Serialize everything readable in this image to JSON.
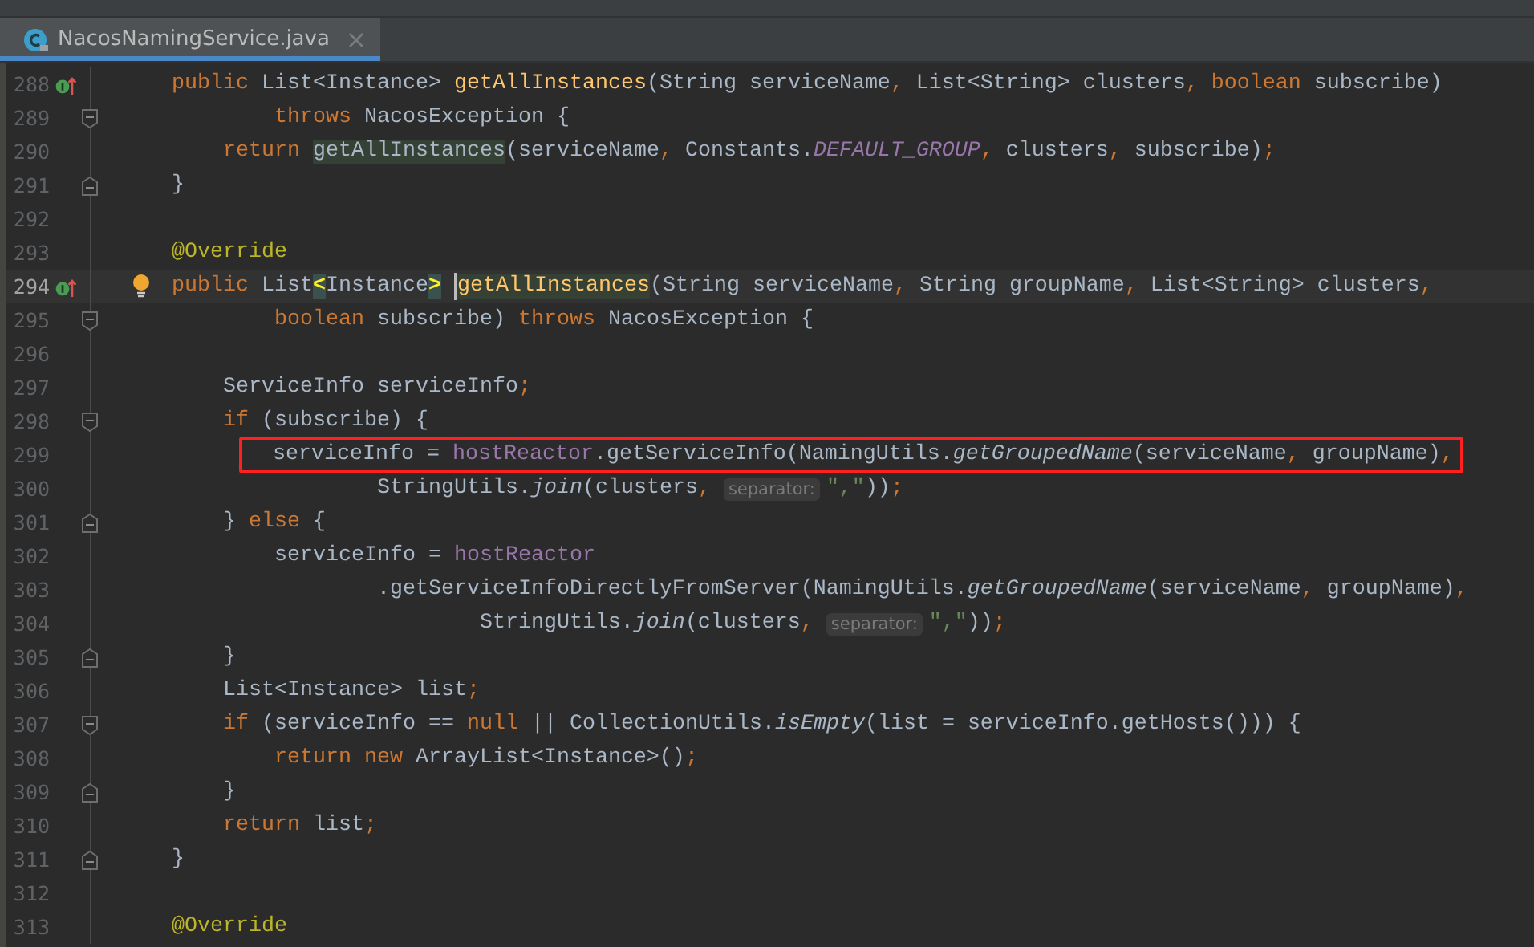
{
  "tab": {
    "title": "NacosNamingService.java",
    "selected": true
  },
  "lines": [
    {
      "number": "288",
      "current": false,
      "boxed": false,
      "markers": [
        {
          "kind": "implements"
        }
      ],
      "tokens": [
        {
          "kind": "keyword",
          "text": "    public"
        },
        {
          "kind": "plain",
          "text": " List<Instance> "
        },
        {
          "kind": "decl",
          "text": "getAllInstances"
        },
        {
          "kind": "plain",
          "text": "(String serviceName"
        },
        {
          "kind": "punct",
          "text": ","
        },
        {
          "kind": "plain",
          "text": " List<String> clusters"
        },
        {
          "kind": "punct",
          "text": ","
        },
        {
          "kind": "keyword",
          "text": " boolean"
        },
        {
          "kind": "plain",
          "text": " subscribe)"
        }
      ]
    },
    {
      "number": "289",
      "current": false,
      "boxed": false,
      "fold": {
        "kind": "start"
      },
      "tokens": [
        {
          "kind": "keyword",
          "text": "            throws"
        },
        {
          "kind": "plain",
          "text": " NacosException {"
        }
      ]
    },
    {
      "number": "290",
      "current": false,
      "boxed": false,
      "tokens": [
        {
          "kind": "keyword",
          "text": "        return "
        },
        {
          "kind": "usage",
          "text": "getAllInstances"
        },
        {
          "kind": "plain",
          "text": "(serviceName"
        },
        {
          "kind": "punct",
          "text": ","
        },
        {
          "kind": "plain",
          "text": " Constants."
        },
        {
          "kind": "static-field",
          "text": "DEFAULT_GROUP"
        },
        {
          "kind": "punct",
          "text": ","
        },
        {
          "kind": "plain",
          "text": " clusters"
        },
        {
          "kind": "punct",
          "text": ","
        },
        {
          "kind": "plain",
          "text": " subscribe)"
        },
        {
          "kind": "punct",
          "text": ";"
        }
      ]
    },
    {
      "number": "291",
      "current": false,
      "boxed": false,
      "fold": {
        "kind": "end"
      },
      "tokens": [
        {
          "kind": "plain",
          "text": "    }"
        }
      ]
    },
    {
      "number": "292",
      "current": false,
      "boxed": false
    },
    {
      "number": "293",
      "current": false,
      "boxed": false,
      "tokens": [
        {
          "kind": "annotation",
          "text": "    @Override"
        }
      ]
    },
    {
      "number": "294",
      "current": true,
      "boxed": false,
      "markers": [
        {
          "kind": "implements"
        },
        {
          "kind": "bulb"
        }
      ],
      "tokens": [
        {
          "kind": "keyword",
          "text": "    public"
        },
        {
          "kind": "plain",
          "text": " List"
        },
        {
          "kind": "brace-match",
          "text": "<"
        },
        {
          "kind": "plain",
          "text": "Instance"
        },
        {
          "kind": "brace-match",
          "text": ">"
        },
        {
          "kind": "caret"
        },
        {
          "kind": "decl-usage",
          "text": "getAllInstances"
        },
        {
          "kind": "plain",
          "text": "(String serviceName"
        },
        {
          "kind": "punct",
          "text": ","
        },
        {
          "kind": "plain",
          "text": " String groupName"
        },
        {
          "kind": "punct",
          "text": ","
        },
        {
          "kind": "plain",
          "text": " List<String> clusters"
        },
        {
          "kind": "punct",
          "text": ","
        }
      ]
    },
    {
      "number": "295",
      "current": false,
      "boxed": false,
      "fold": {
        "kind": "start"
      },
      "tokens": [
        {
          "kind": "keyword",
          "text": "            boolean"
        },
        {
          "kind": "plain",
          "text": " subscribe) "
        },
        {
          "kind": "keyword",
          "text": "throws"
        },
        {
          "kind": "plain",
          "text": " NacosException {"
        }
      ]
    },
    {
      "number": "296",
      "current": false,
      "boxed": false
    },
    {
      "number": "297",
      "current": false,
      "boxed": false,
      "tokens": [
        {
          "kind": "plain",
          "text": "        ServiceInfo serviceInfo"
        },
        {
          "kind": "punct",
          "text": ";"
        }
      ]
    },
    {
      "number": "298",
      "current": false,
      "boxed": false,
      "fold": {
        "kind": "start"
      },
      "tokens": [
        {
          "kind": "keyword",
          "text": "        if"
        },
        {
          "kind": "plain",
          "text": " (subscribe) {"
        }
      ]
    },
    {
      "number": "299",
      "current": false,
      "boxed": true,
      "tokens": [
        {
          "kind": "plain",
          "text": "            serviceInfo = "
        },
        {
          "kind": "field",
          "text": "hostReactor"
        },
        {
          "kind": "plain",
          "text": ".getServiceInfo(NamingUtils."
        },
        {
          "kind": "static-method",
          "text": "getGroupedName"
        },
        {
          "kind": "plain",
          "text": "(serviceName"
        },
        {
          "kind": "punct",
          "text": ","
        },
        {
          "kind": "plain",
          "text": " groupName)"
        },
        {
          "kind": "punct",
          "text": ","
        }
      ]
    },
    {
      "number": "300",
      "current": false,
      "boxed": false,
      "tokens": [
        {
          "kind": "plain",
          "text": "                    StringUtils."
        },
        {
          "kind": "static-method",
          "text": "join"
        },
        {
          "kind": "plain",
          "text": "(clusters"
        },
        {
          "kind": "punct",
          "text": ","
        },
        {
          "kind": "hint",
          "text": "separator:"
        },
        {
          "kind": "string",
          "text": "\",\""
        },
        {
          "kind": "plain",
          "text": "))"
        },
        {
          "kind": "punct",
          "text": ";"
        }
      ]
    },
    {
      "number": "301",
      "current": false,
      "boxed": false,
      "fold": {
        "kind": "end"
      },
      "tokens": [
        {
          "kind": "plain",
          "text": "        } "
        },
        {
          "kind": "keyword",
          "text": "else"
        },
        {
          "kind": "plain",
          "text": " {"
        }
      ]
    },
    {
      "number": "302",
      "current": false,
      "boxed": false,
      "tokens": [
        {
          "kind": "plain",
          "text": "            serviceInfo = "
        },
        {
          "kind": "field",
          "text": "hostReactor"
        }
      ]
    },
    {
      "number": "303",
      "current": false,
      "boxed": false,
      "tokens": [
        {
          "kind": "plain",
          "text": "                    .getServiceInfoDirectlyFromServer(NamingUtils."
        },
        {
          "kind": "static-method",
          "text": "getGroupedName"
        },
        {
          "kind": "plain",
          "text": "(serviceName"
        },
        {
          "kind": "punct",
          "text": ","
        },
        {
          "kind": "plain",
          "text": " groupName)"
        },
        {
          "kind": "punct",
          "text": ","
        }
      ]
    },
    {
      "number": "304",
      "current": false,
      "boxed": false,
      "tokens": [
        {
          "kind": "plain",
          "text": "                            StringUtils."
        },
        {
          "kind": "static-method",
          "text": "join"
        },
        {
          "kind": "plain",
          "text": "(clusters"
        },
        {
          "kind": "punct",
          "text": ","
        },
        {
          "kind": "hint",
          "text": "separator:"
        },
        {
          "kind": "string",
          "text": "\",\""
        },
        {
          "kind": "plain",
          "text": "))"
        },
        {
          "kind": "punct",
          "text": ";"
        }
      ]
    },
    {
      "number": "305",
      "current": false,
      "boxed": false,
      "fold": {
        "kind": "end"
      },
      "tokens": [
        {
          "kind": "plain",
          "text": "        }"
        }
      ]
    },
    {
      "number": "306",
      "current": false,
      "boxed": false,
      "tokens": [
        {
          "kind": "plain",
          "text": "        List<Instance> list"
        },
        {
          "kind": "punct",
          "text": ";"
        }
      ]
    },
    {
      "number": "307",
      "current": false,
      "boxed": false,
      "fold": {
        "kind": "start"
      },
      "tokens": [
        {
          "kind": "keyword",
          "text": "        if"
        },
        {
          "kind": "plain",
          "text": " (serviceInfo == "
        },
        {
          "kind": "keyword",
          "text": "null"
        },
        {
          "kind": "plain",
          "text": " || CollectionUtils."
        },
        {
          "kind": "static-method",
          "text": "isEmpty"
        },
        {
          "kind": "plain",
          "text": "(list = serviceInfo.getHosts())) {"
        }
      ]
    },
    {
      "number": "308",
      "current": false,
      "boxed": false,
      "tokens": [
        {
          "kind": "keyword",
          "text": "            return new"
        },
        {
          "kind": "plain",
          "text": " ArrayList<Instance>()"
        },
        {
          "kind": "punct",
          "text": ";"
        }
      ]
    },
    {
      "number": "309",
      "current": false,
      "boxed": false,
      "fold": {
        "kind": "end"
      },
      "tokens": [
        {
          "kind": "plain",
          "text": "        }"
        }
      ]
    },
    {
      "number": "310",
      "current": false,
      "boxed": false,
      "tokens": [
        {
          "kind": "keyword",
          "text": "        return"
        },
        {
          "kind": "plain",
          "text": " list"
        },
        {
          "kind": "punct",
          "text": ";"
        }
      ]
    },
    {
      "number": "311",
      "current": false,
      "boxed": false,
      "fold": {
        "kind": "end"
      },
      "tokens": [
        {
          "kind": "plain",
          "text": "    }"
        }
      ]
    },
    {
      "number": "312",
      "current": false,
      "boxed": false
    },
    {
      "number": "313",
      "current": false,
      "boxed": false,
      "tokens": [
        {
          "kind": "annotation",
          "text": "    @Override"
        }
      ]
    }
  ]
}
